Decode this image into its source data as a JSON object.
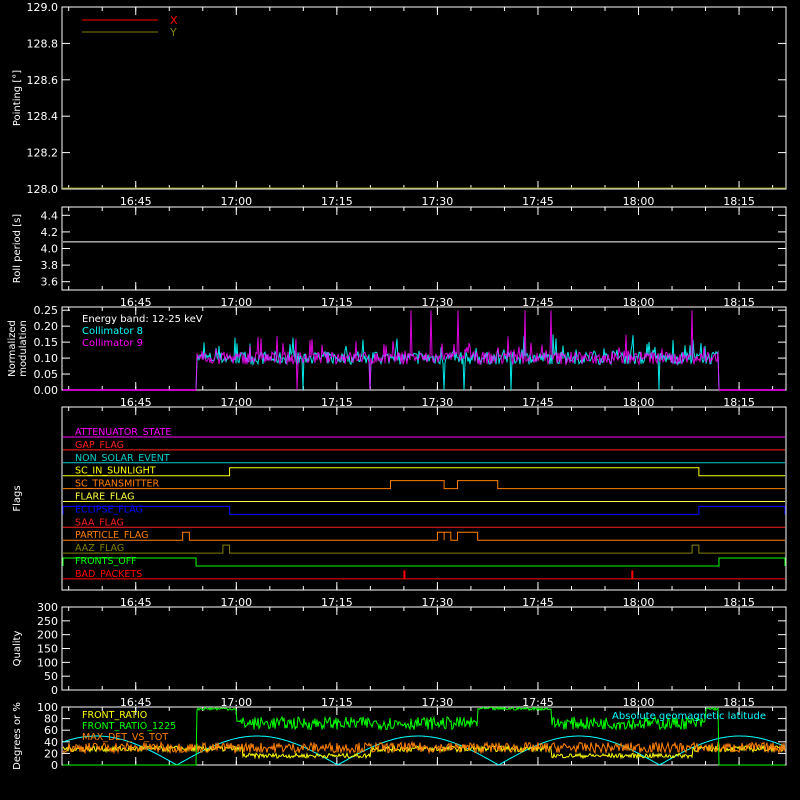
{
  "time_ticks": [
    "16:45",
    "17:00",
    "17:15",
    "17:30",
    "17:45",
    "18:00",
    "18:15"
  ],
  "time_range": [
    "16:34",
    "18:22"
  ],
  "chart_data": [
    {
      "id": "pointing",
      "type": "line",
      "ylabel": "Pointing [°]",
      "ylim": [
        128.0,
        129.0
      ],
      "yticks": [
        "128.0",
        "128.2",
        "128.4",
        "128.6",
        "128.8",
        "129.0"
      ],
      "legend": [
        {
          "name": "X",
          "color": "#ff0000"
        },
        {
          "name": "Y",
          "color": "#808000"
        }
      ],
      "series": [
        {
          "name": "X",
          "color": "#ff0000",
          "x": [
            "16:34",
            "18:22"
          ],
          "y": [
            128.0,
            128.0
          ]
        },
        {
          "name": "Y",
          "color": "#808000",
          "x": [
            "16:34",
            "18:22"
          ],
          "y": [
            128.0,
            128.0
          ]
        }
      ]
    },
    {
      "id": "roll-period",
      "type": "line",
      "ylabel": "Roll period [s]",
      "ylim": [
        3.5,
        4.5
      ],
      "yticks": [
        "3.6",
        "3.8",
        "4.0",
        "4.2",
        "4.4"
      ],
      "series": [
        {
          "color": "#ffffff",
          "x": [
            "16:34",
            "18:22"
          ],
          "y": [
            4.08,
            4.08
          ]
        }
      ]
    },
    {
      "id": "modulation",
      "type": "line",
      "ylabel": "Normalized modulation",
      "ylim": [
        0,
        0.26
      ],
      "yticks": [
        "0.00",
        "0.05",
        "0.10",
        "0.15",
        "0.20",
        "0.25"
      ],
      "annotation": "Energy band: 12-25 keV",
      "legend": [
        {
          "name": "Collimator 8",
          "color": "#00ffff"
        },
        {
          "name": "Collimator 9",
          "color": "#ff00ff"
        }
      ],
      "active_range": [
        "16:54",
        "18:12"
      ],
      "baseline": 0.1,
      "series": [
        {
          "name": "Collimator 8",
          "color": "#00ffff",
          "dips": [
            "17:10",
            "17:20",
            "17:31",
            "17:34",
            "17:41",
            "18:03"
          ]
        },
        {
          "name": "Collimator 9",
          "color": "#ff00ff",
          "dips": [
            "17:09",
            "17:20"
          ],
          "spikes": [
            "17:26",
            "17:29",
            "17:33",
            "17:43",
            "17:47",
            "18:08"
          ]
        }
      ]
    },
    {
      "id": "flags",
      "type": "step",
      "ylabel": "Flags",
      "flags": [
        {
          "name": "ATTENUATOR_STATE",
          "color": "#ff00ff",
          "segments": []
        },
        {
          "name": "GAP_FLAG",
          "color": "#ff2020",
          "segments": []
        },
        {
          "name": "NON_SOLAR_EVENT",
          "color": "#00cccc",
          "segments": []
        },
        {
          "name": "SC_IN_SUNLIGHT",
          "color": "#ffff00",
          "segments": [
            [
              "16:59",
              "18:09"
            ]
          ]
        },
        {
          "name": "SC_TRANSMITTER",
          "color": "#ff8000",
          "segments": [
            [
              "17:23",
              "17:31"
            ],
            [
              "17:33",
              "17:39"
            ]
          ]
        },
        {
          "name": "FLARE_FLAG",
          "color": "#ffff40",
          "segments": []
        },
        {
          "name": "ECLIPSE_FLAG",
          "color": "#0000ff",
          "segments": [
            [
              "16:34",
              "16:59"
            ],
            [
              "18:09",
              "18:22"
            ]
          ]
        },
        {
          "name": "SAA_FLAG",
          "color": "#ff2020",
          "segments": []
        },
        {
          "name": "PARTICLE_FLAG",
          "color": "#ff8000",
          "segments": [
            [
              "16:52",
              "16:53"
            ],
            [
              "17:30",
              "17:31"
            ],
            [
              "17:31",
              "17:32"
            ],
            [
              "17:33",
              "17:36"
            ]
          ]
        },
        {
          "name": "AAZ_FLAG",
          "color": "#808000",
          "segments": [
            [
              "16:58",
              "16:59"
            ],
            [
              "18:08",
              "18:09"
            ]
          ]
        },
        {
          "name": "FRONTS_OFF",
          "color": "#00ff00",
          "segments": [
            [
              "16:34",
              "16:54"
            ],
            [
              "18:12",
              "18:22"
            ]
          ]
        },
        {
          "name": "BAD_PACKETS",
          "color": "#ff0000",
          "segments": [
            [
              "17:25",
              "17:25"
            ],
            [
              "17:59",
              "17:59"
            ]
          ]
        }
      ]
    },
    {
      "id": "quality",
      "type": "line",
      "ylabel": "Quality",
      "ylim": [
        0,
        300
      ],
      "yticks": [
        "0",
        "50",
        "100",
        "150",
        "200",
        "250",
        "300"
      ],
      "series": []
    },
    {
      "id": "ratios",
      "type": "line",
      "ylabel": "Degrees or %",
      "ylim": [
        0,
        100
      ],
      "yticks": [
        "0",
        "20",
        "40",
        "60",
        "80",
        "100"
      ],
      "legend": [
        {
          "name": "FRONT_RATIO",
          "color": "#ffff00"
        },
        {
          "name": "FRONT_RATIO_1225",
          "color": "#00ff00"
        },
        {
          "name": "MAX_DET_VS_TOT",
          "color": "#ff8000"
        }
      ],
      "right_legend": {
        "name": "Absolute geomagnetic latitude",
        "color": "#00ffff"
      },
      "series": [
        {
          "name": "FRONT_RATIO_1225",
          "color": "#00ff00",
          "high_ranges": [
            [
              "16:54",
              "17:00"
            ],
            [
              "17:36",
              "17:47"
            ],
            [
              "18:10",
              "18:12"
            ]
          ],
          "high": 97,
          "mid": 72
        },
        {
          "name": "MAX_DET_VS_TOT",
          "color": "#ff8000",
          "level": 30
        },
        {
          "name": "FRONT_RATIO",
          "color": "#ffff00",
          "low_ranges": [
            [
              "17:01",
              "17:20"
            ],
            [
              "17:47",
              "18:08"
            ]
          ],
          "low": 12,
          "level": 28
        },
        {
          "name": "Absolute geomagnetic latitude",
          "color": "#00ffff",
          "amplitude": 50
        }
      ]
    }
  ]
}
